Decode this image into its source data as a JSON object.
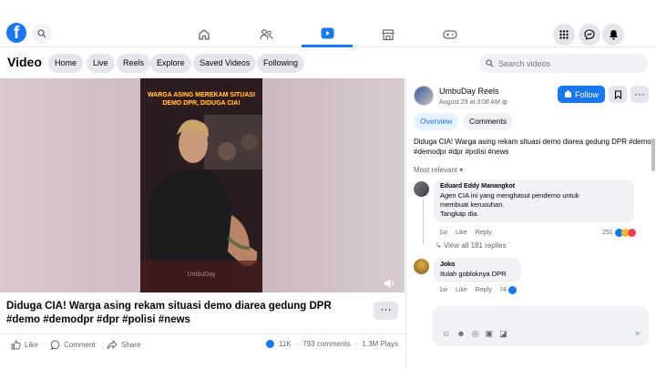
{
  "header": {
    "logo": "f",
    "nav_icons": [
      "home-icon",
      "friends-icon",
      "video-icon",
      "marketplace-icon",
      "gaming-icon"
    ],
    "right_icons": [
      "menu-grid-icon",
      "messenger-icon",
      "bell-icon"
    ]
  },
  "subnav": {
    "title": "Video",
    "chips": [
      "Home",
      "Live",
      "Reels",
      "Explore",
      "Saved Videos",
      "Following"
    ],
    "search_placeholder": "Search videos"
  },
  "video": {
    "caption": "WARGA ASING MEREKAM SITUASI DEMO DPR, DIDUGA CIA!",
    "watermark": "UmbuDay",
    "title": "Diduga CIA! Warga asing rekam situasi demo diarea gedung DPR #demo #demodpr #dpr #polisi #news",
    "more_label": "···"
  },
  "actions": {
    "like": "Like",
    "comment": "Comment",
    "share": "Share",
    "reactions_count": "11K",
    "comments_count": "793 comments",
    "plays_count": "1.3M Plays"
  },
  "panel": {
    "page_name": "UmbuDay Reels",
    "date": "August 29 at 3:08 AM",
    "follow_label": "Follow",
    "tabs": [
      "Overview",
      "Comments"
    ],
    "description": "Diduga CIA! Warga asing rekam situasi demo diarea gedung DPR #demo #demodpr #dpr #polisi #news",
    "sort_label": "Most relevant"
  },
  "comments": [
    {
      "name": "Eduard Eddy Manangkot",
      "text_lines": [
        "Agen CIA ini yang menghasut pendemo untuk",
        "membuat kerusuhan.",
        "Tangkap dia."
      ],
      "time": "1w",
      "like": "Like",
      "reply": "Reply",
      "reactions": "251",
      "view_replies": "View all 181 replies"
    },
    {
      "name": "Joko",
      "text_lines": [
        "Itulah gobloknya DPR"
      ],
      "time": "1w",
      "like": "Like",
      "reply": "Reply",
      "reactions": "74"
    }
  ],
  "composer": {
    "placeholder": ""
  },
  "colors": {
    "brand": "#1877f2",
    "muted": "#65676b",
    "chip": "#e4e6eb"
  }
}
